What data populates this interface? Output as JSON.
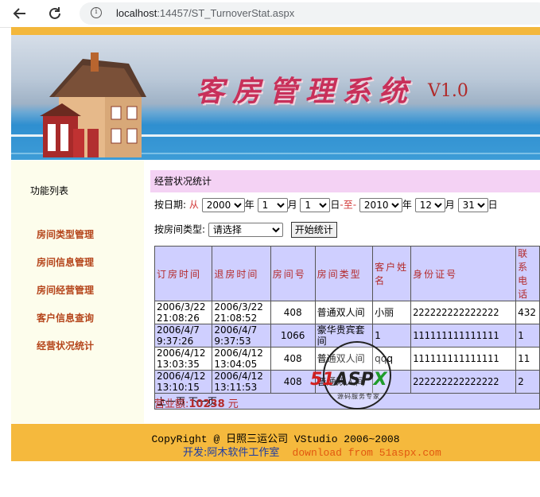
{
  "browser": {
    "url_host": "localhost",
    "url_rest": ":14457/ST_TurnoverStat.aspx"
  },
  "banner": {
    "title": "客房管理系统",
    "version": "V1.0"
  },
  "sidebar": {
    "title": "功能列表",
    "items": [
      {
        "label": "房间类型管理"
      },
      {
        "label": "房间信息管理"
      },
      {
        "label": "房间经营管理"
      },
      {
        "label": "客户信息查询"
      },
      {
        "label": "经营状况统计"
      }
    ]
  },
  "main": {
    "section_title": "经营状况统计",
    "by_date_label": "按日期:",
    "from_label": "从",
    "year_label": "年",
    "month_label": "月",
    "day_label": "日",
    "to_label": "-至-",
    "start_year": "2000",
    "start_month": "1",
    "start_day": "1",
    "end_year": "2010",
    "end_month": "12",
    "end_day": "31",
    "room_type_label": "按房间类型:",
    "room_type_value": "请选择",
    "start_button": "开始统计",
    "columns": [
      "订房时间",
      "退房时间",
      "房间号",
      "房间类型",
      "客户姓名",
      "身份证号",
      "联系电话"
    ],
    "rows": [
      {
        "checkin": "2006/3/22 21:08:26",
        "checkout": "2006/3/22 21:08:52",
        "room": "408",
        "type": "普通双人间",
        "name": "小丽",
        "id": "222222222222222",
        "phone": "432"
      },
      {
        "checkin": "2006/4/7 9:37:26",
        "checkout": "2006/4/7 9:37:53",
        "room": "1066",
        "type": "豪华贵宾套间",
        "name": "1",
        "id": "111111111111111",
        "phone": "1"
      },
      {
        "checkin": "2006/4/12 13:03:35",
        "checkout": "2006/4/12 13:04:05",
        "room": "408",
        "type": "普通双人间",
        "name": "qqq",
        "id": "111111111111111",
        "phone": "11"
      },
      {
        "checkin": "2006/4/12 13:10:15",
        "checkout": "2006/4/12 13:11:53",
        "room": "408",
        "type": "普通双人间",
        "name": "",
        "id": "222222222222222",
        "phone": "2"
      }
    ],
    "pager": "上一页 下一页",
    "revenue_label": "营业额:",
    "revenue_value": "10238",
    "revenue_unit": "元"
  },
  "footer": {
    "copyright": "CopyRight @ 日照三运公司 VStudio 2006~2008",
    "dev_label": "开发:",
    "dev_name": "阿木软件工作室",
    "download": "download from 51aspx.com"
  },
  "watermark": {
    "brand_red": "51",
    "brand_dark": "ASP",
    "brand_green": "X",
    "slogan": "源码服务专家"
  },
  "colors": {
    "accent_orange": "#f5b93d",
    "menu_text": "#b5451b",
    "header_purple": "#cfcfff",
    "section_pink": "#f4d2f4",
    "title_red": "#c8305a"
  }
}
